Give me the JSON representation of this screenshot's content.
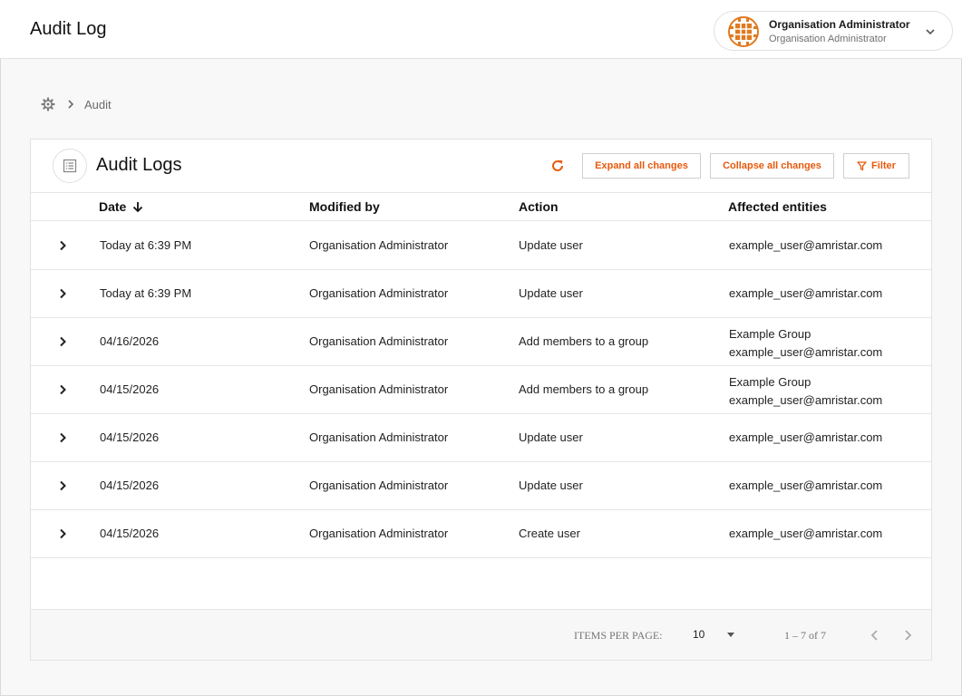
{
  "header": {
    "title": "Audit Log",
    "user": {
      "name": "Organisation Administrator",
      "role": "Organisation Administrator"
    }
  },
  "breadcrumb": {
    "current": "Audit"
  },
  "card": {
    "title": "Audit Logs",
    "expand_label": "Expand all changes",
    "collapse_label": "Collapse all changes",
    "filter_label": "Filter"
  },
  "table": {
    "columns": {
      "date": "Date",
      "modified_by": "Modified by",
      "action": "Action",
      "entities": "Affected entities"
    },
    "rows": [
      {
        "date": "Today at 6:39 PM",
        "modified_by": "Organisation Administrator",
        "action": "Update user",
        "entities": [
          "example_user@amristar.com"
        ]
      },
      {
        "date": "Today at 6:39 PM",
        "modified_by": "Organisation Administrator",
        "action": "Update user",
        "entities": [
          "example_user@amristar.com"
        ]
      },
      {
        "date": "04/16/2026",
        "modified_by": "Organisation Administrator",
        "action": "Add members to a group",
        "entities": [
          "Example Group",
          "example_user@amristar.com"
        ]
      },
      {
        "date": "04/15/2026",
        "modified_by": "Organisation Administrator",
        "action": "Add members to a group",
        "entities": [
          "Example Group",
          "example_user@amristar.com"
        ]
      },
      {
        "date": "04/15/2026",
        "modified_by": "Organisation Administrator",
        "action": "Update user",
        "entities": [
          "example_user@amristar.com"
        ]
      },
      {
        "date": "04/15/2026",
        "modified_by": "Organisation Administrator",
        "action": "Update user",
        "entities": [
          "example_user@amristar.com"
        ]
      },
      {
        "date": "04/15/2026",
        "modified_by": "Organisation Administrator",
        "action": "Create user",
        "entities": [
          "example_user@amristar.com"
        ]
      }
    ]
  },
  "paginator": {
    "items_per_page_label": "ITEMS PER PAGE:",
    "items_per_page": "10",
    "range": "1 – 7 of 7"
  },
  "icons": {
    "avatar": "org-logo-icon",
    "breadcrumb_root": "gear-icon",
    "card": "list-icon",
    "refresh": "refresh-icon",
    "filter": "filter-icon",
    "sort": "arrow-down-icon",
    "row_expand": "chevron-right-icon"
  },
  "colors": {
    "accent": "#e8590c",
    "avatar": "#e07a1f"
  }
}
